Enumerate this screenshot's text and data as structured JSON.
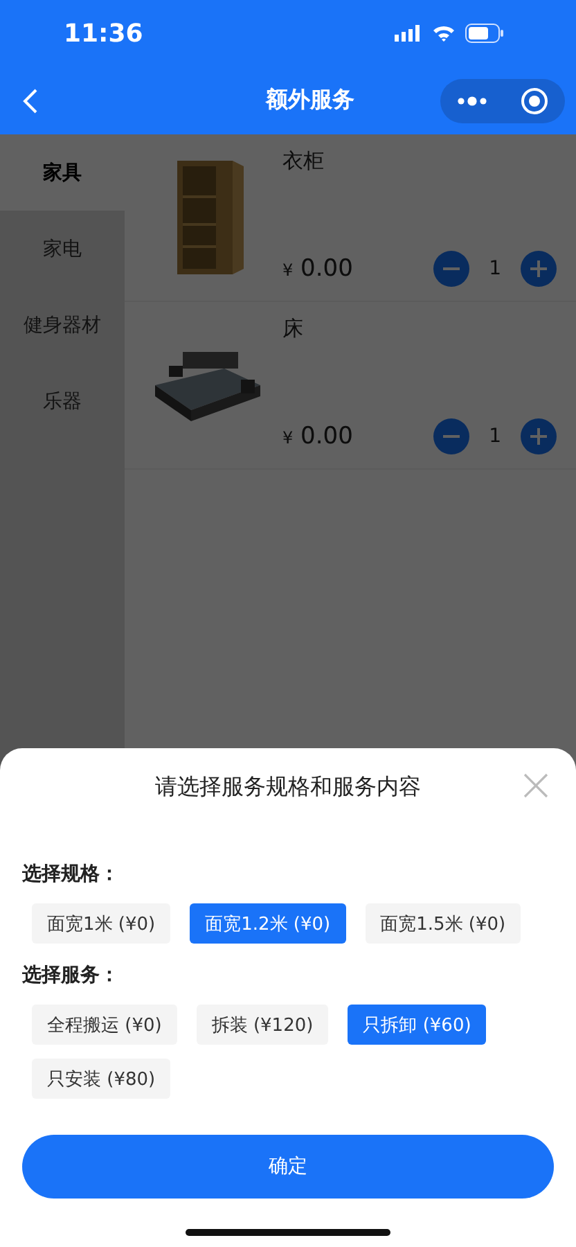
{
  "status_bar": {
    "time": "11:36"
  },
  "nav": {
    "title": "额外服务"
  },
  "categories": [
    {
      "label": "家具",
      "selected": true
    },
    {
      "label": "家电",
      "selected": false
    },
    {
      "label": "健身器材",
      "selected": false
    },
    {
      "label": "乐器",
      "selected": false
    }
  ],
  "products": [
    {
      "kind": "wardrobe",
      "name": "衣柜",
      "currency": "¥",
      "price": "0.00",
      "quantity": "1"
    },
    {
      "kind": "bed",
      "name": "床",
      "currency": "¥",
      "price": "0.00",
      "quantity": "1"
    }
  ],
  "sheet": {
    "title": "请选择服务规格和服务内容",
    "groups": [
      {
        "label": "选择规格：",
        "options": [
          {
            "label": "面宽1米 (¥0)",
            "selected": false
          },
          {
            "label": "面宽1.2米 (¥0)",
            "selected": true
          },
          {
            "label": "面宽1.5米 (¥0)",
            "selected": false
          }
        ]
      },
      {
        "label": "选择服务：",
        "options": [
          {
            "label": "全程搬运 (¥0)",
            "selected": false
          },
          {
            "label": "拆装 (¥120)",
            "selected": false
          },
          {
            "label": "只拆卸 (¥60)",
            "selected": true
          },
          {
            "label": "只安装 (¥80)",
            "selected": false
          }
        ]
      }
    ],
    "confirm": "确定"
  }
}
